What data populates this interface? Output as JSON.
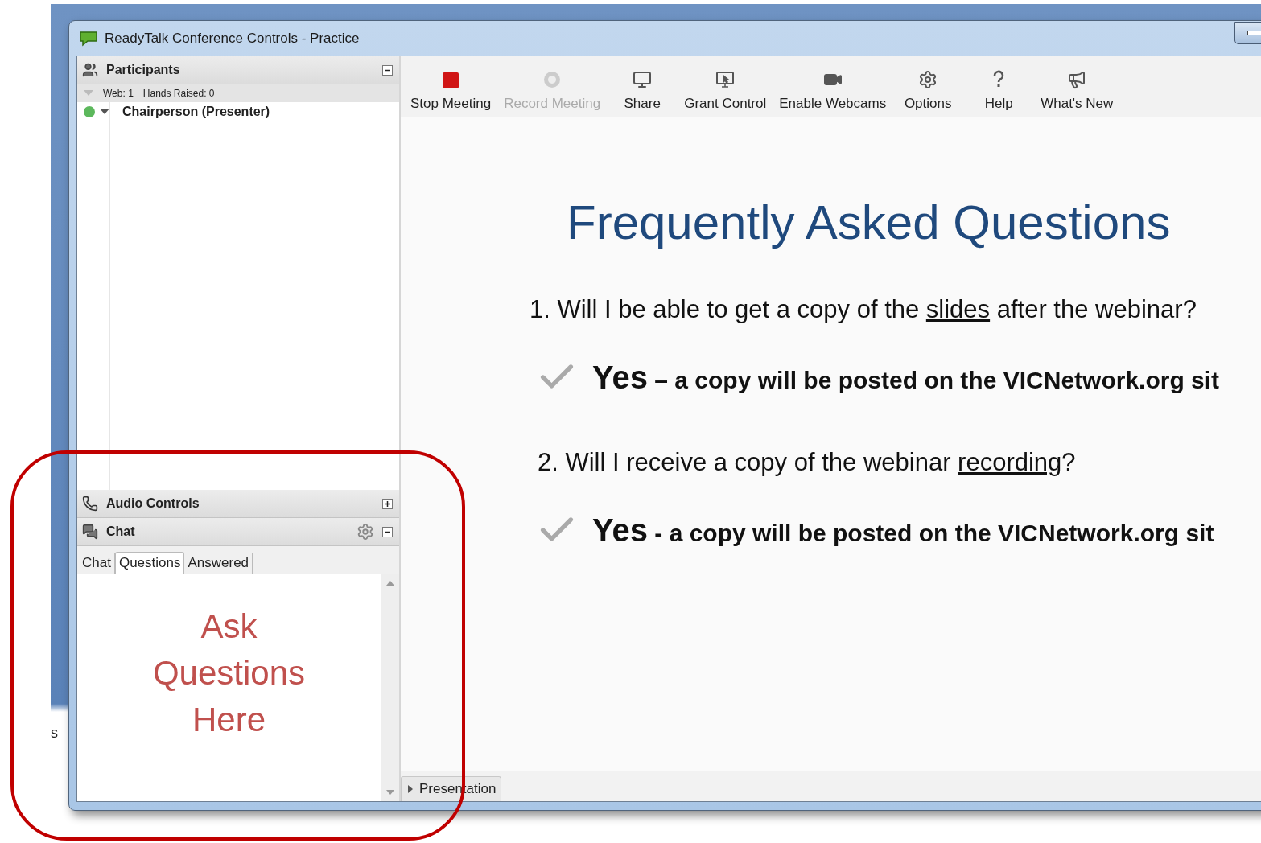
{
  "desktop": {
    "fragment": "s"
  },
  "window": {
    "title": "ReadyTalk Conference Controls - Practice"
  },
  "participants_panel": {
    "title": "Participants",
    "expanded": true,
    "web_count": "Web: 1",
    "hands_raised": "Hands Raised: 0",
    "participants": [
      {
        "name": "Chairperson (Presenter)",
        "color": "#5cb85c",
        "expanded": true
      }
    ]
  },
  "audio_panel": {
    "title": "Audio Controls",
    "expanded": false
  },
  "chat_panel": {
    "title": "Chat",
    "expanded": true,
    "tabs": [
      {
        "label": "Chat",
        "selected": false
      },
      {
        "label": "Questions",
        "selected": true
      },
      {
        "label": "Answered",
        "selected": false
      }
    ]
  },
  "toolbar": [
    {
      "kind": "stop",
      "label": "Stop Meeting",
      "disabled": false
    },
    {
      "kind": "record",
      "label": "Record Meeting",
      "disabled": true
    },
    {
      "kind": "share",
      "label": "Share",
      "disabled": false
    },
    {
      "kind": "grant",
      "label": "Grant Control",
      "disabled": false
    },
    {
      "kind": "webcam",
      "label": "Enable Webcams",
      "disabled": false
    },
    {
      "kind": "options",
      "label": "Options",
      "disabled": false
    },
    {
      "kind": "help",
      "label": "Help",
      "disabled": false
    },
    {
      "kind": "news",
      "label": "What's New",
      "disabled": false
    }
  ],
  "slide": {
    "title": "Frequently Asked Questions",
    "items": [
      {
        "kind": "question",
        "before": "1. Will I be able to get a copy of the ",
        "underlined": "slides",
        "after": " after the webinar?"
      },
      {
        "kind": "answer",
        "lead": "Yes",
        "rest": " – a copy will be posted on the VICNetwork.org sit"
      },
      {
        "kind": "question",
        "before": "2. Will I receive a copy of the webinar ",
        "underlined": "recording",
        "after": "?"
      },
      {
        "kind": "answer",
        "lead": "Yes",
        "rest": " - a copy will be posted on the VICNetwork.org sit"
      }
    ]
  },
  "bottom_tabs": [
    {
      "label": "Presentation",
      "selected": true
    }
  ],
  "annotation": {
    "text": "Ask Questions Here"
  }
}
